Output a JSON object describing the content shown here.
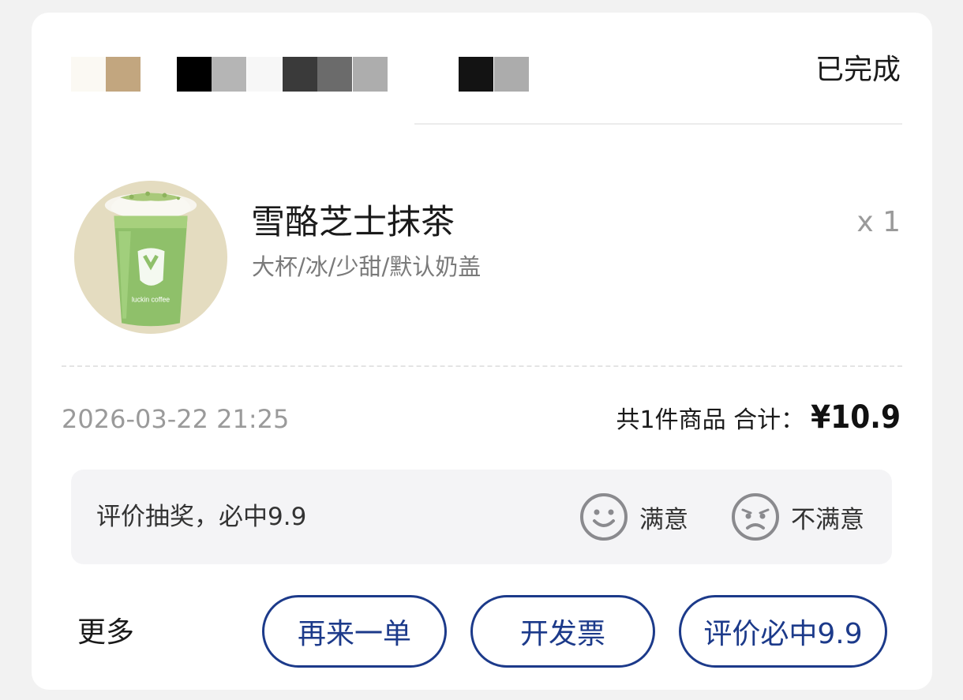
{
  "store": {
    "name_swatches": [
      "#fbf9f3",
      "#c2a67f",
      "#000000",
      "#b5b5b5",
      "#f7f7f7",
      "#3a3a3a",
      "#6b6b6b",
      "#adadad",
      "#131313",
      "#acacac"
    ]
  },
  "order": {
    "status": "已完成",
    "time": "2026-03-22 21:25",
    "summary_label": "共1件商品 合计：",
    "total": "¥10.9"
  },
  "product": {
    "name": "雪酪芝士抹茶",
    "spec": "大杯/冰/少甜/默认奶盖",
    "qty": "x 1",
    "image_icon": "matcha-drink-image"
  },
  "review": {
    "prompt": "评价抽奖，必中9.9",
    "satisfied_label": "满意",
    "unsatisfied_label": "不满意",
    "satisfied_icon": "smile-face-icon",
    "unsatisfied_icon": "sad-face-icon"
  },
  "actions": {
    "more_label": "更多",
    "reorder_label": "再来一单",
    "invoice_label": "开发票",
    "review_label": "评价必中9.9"
  },
  "colors": {
    "accent": "#1c3a8a",
    "muted": "#9a9a9a",
    "panel": "#f4f4f6"
  }
}
